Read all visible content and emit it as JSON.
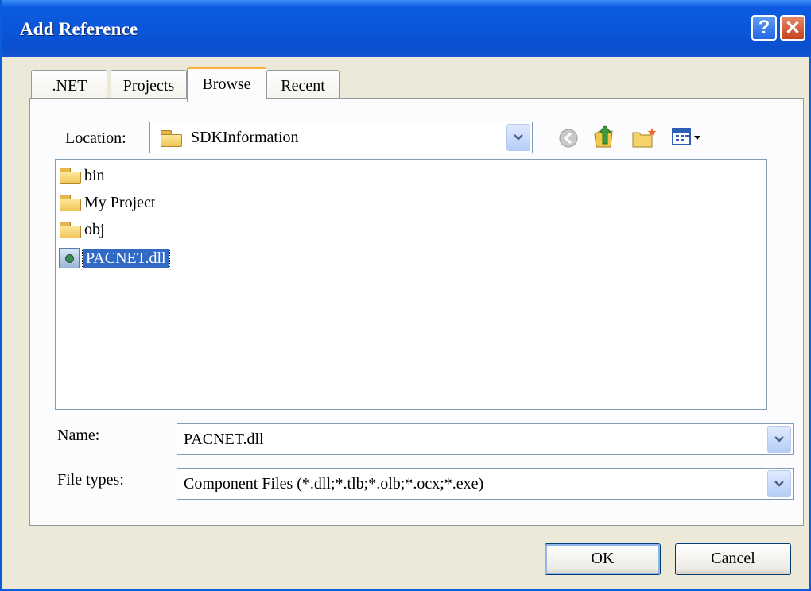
{
  "window": {
    "title": "Add Reference"
  },
  "tabs": [
    {
      "label": ".NET",
      "active": false
    },
    {
      "label": "Projects",
      "active": false
    },
    {
      "label": "Browse",
      "active": true
    },
    {
      "label": "Recent",
      "active": false
    }
  ],
  "location": {
    "label": "Location:",
    "value": "SDKInformation"
  },
  "toolbar_icons": [
    "back-icon",
    "up-folder-icon",
    "new-folder-icon",
    "view-menu-icon"
  ],
  "files": [
    {
      "name": "bin",
      "type": "folder",
      "selected": false
    },
    {
      "name": "My Project",
      "type": "folder",
      "selected": false
    },
    {
      "name": "obj",
      "type": "folder",
      "selected": false
    },
    {
      "name": "PACNET.dll",
      "type": "dll",
      "selected": true
    }
  ],
  "name_field": {
    "label": "Name:",
    "value": "PACNET.dll"
  },
  "file_types": {
    "label": "File types:",
    "value": "Component Files (*.dll;*.tlb;*.olb;*.ocx;*.exe)"
  },
  "buttons": {
    "ok": "OK",
    "cancel": "Cancel"
  },
  "colors": {
    "title_bar": "#0b55d9",
    "selection": "#316ac5",
    "active_tab_accent": "#f7b23c"
  }
}
